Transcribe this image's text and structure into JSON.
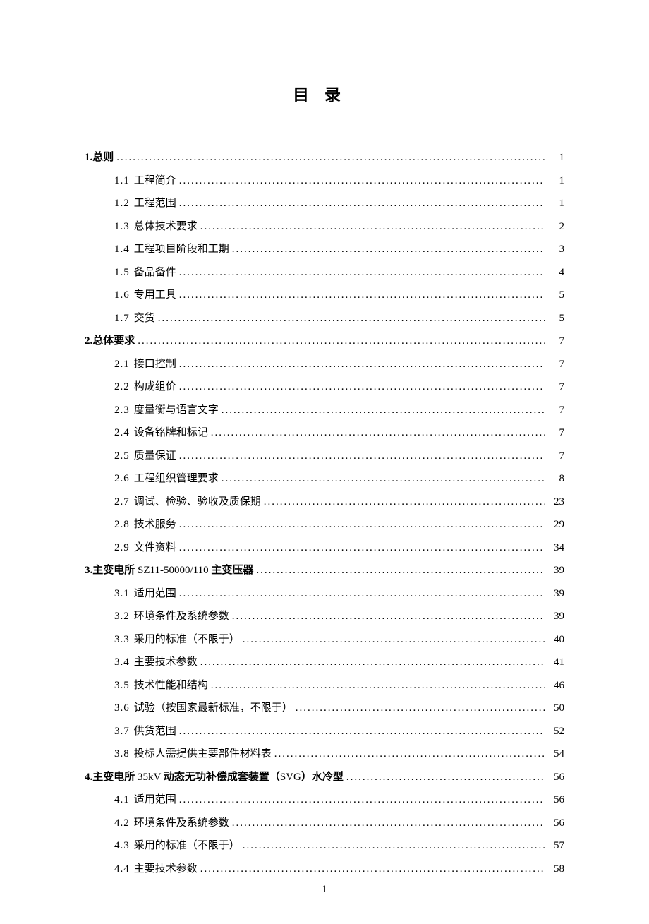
{
  "title": "目录",
  "footer_page": "1",
  "toc": [
    {
      "level": 1,
      "num": "1.",
      "label": "总则",
      "page": "1",
      "bold_all": true
    },
    {
      "level": 2,
      "num": "1.1",
      "label": "工程简介",
      "page": "1"
    },
    {
      "level": 2,
      "num": "1.2",
      "label": "工程范围",
      "page": "1"
    },
    {
      "level": 2,
      "num": "1.3",
      "label": "总体技术要求",
      "page": "2"
    },
    {
      "level": 2,
      "num": "1.4",
      "label": "工程项目阶段和工期",
      "page": "3"
    },
    {
      "level": 2,
      "num": "1.5",
      "label": "备品备件",
      "page": "4"
    },
    {
      "level": 2,
      "num": "1.6",
      "label": "专用工具",
      "page": "5"
    },
    {
      "level": 2,
      "num": "1.7",
      "label": "交货",
      "page": "5"
    },
    {
      "level": 1,
      "num": "2.",
      "label": "总体要求",
      "page": "7",
      "bold_all": true
    },
    {
      "level": 2,
      "num": "2.1",
      "label": "接口控制",
      "page": "7"
    },
    {
      "level": 2,
      "num": "2.2",
      "label": "构成组价",
      "page": "7"
    },
    {
      "level": 2,
      "num": "2.3",
      "label": "度量衡与语言文字",
      "page": "7"
    },
    {
      "level": 2,
      "num": "2.4",
      "label": "设备铭牌和标记",
      "page": "7"
    },
    {
      "level": 2,
      "num": "2.5",
      "label": "质量保证",
      "page": "7"
    },
    {
      "level": 2,
      "num": "2.6",
      "label": "工程组织管理要求",
      "page": "8"
    },
    {
      "level": 2,
      "num": "2.7",
      "label": "调试、检验、验收及质保期",
      "page": "23"
    },
    {
      "level": 2,
      "num": "2.8",
      "label": "技术服务",
      "page": "29"
    },
    {
      "level": 2,
      "num": "2.9",
      "label": "文件资料",
      "page": "34"
    },
    {
      "level": 1,
      "num": "3.",
      "label_parts": [
        {
          "t": "主变电所",
          "b": true
        },
        {
          "t": " SZ11-50000/110 ",
          "b": false
        },
        {
          "t": "主变压器",
          "b": true
        }
      ],
      "page": "39"
    },
    {
      "level": 2,
      "num": "3.1",
      "label": "适用范围",
      "page": "39"
    },
    {
      "level": 2,
      "num": "3.2",
      "label": "环境条件及系统参数",
      "page": "39"
    },
    {
      "level": 2,
      "num": "3.3",
      "label": "采用的标准（不限于）",
      "page": "40"
    },
    {
      "level": 2,
      "num": "3.4",
      "label": "主要技术参数",
      "page": "41"
    },
    {
      "level": 2,
      "num": "3.5",
      "label": "技术性能和结构",
      "page": "46"
    },
    {
      "level": 2,
      "num": "3.6",
      "label": "试验（按国家最新标准，不限于）",
      "page": "50"
    },
    {
      "level": 2,
      "num": "3.7",
      "label": "供货范围",
      "page": "52"
    },
    {
      "level": 2,
      "num": "3.8",
      "label": "投标人需提供主要部件材料表",
      "page": "54"
    },
    {
      "level": 1,
      "num": "4.",
      "label_parts": [
        {
          "t": "主变电所",
          "b": true
        },
        {
          "t": " 35kV ",
          "b": false
        },
        {
          "t": "动态无功补偿成套装置（",
          "b": true
        },
        {
          "t": "SVG",
          "b": false
        },
        {
          "t": "）水冷型",
          "b": true
        }
      ],
      "page": "56"
    },
    {
      "level": 2,
      "num": "4.1",
      "label": "适用范围",
      "page": "56"
    },
    {
      "level": 2,
      "num": "4.2",
      "label": "环境条件及系统参数",
      "page": "56"
    },
    {
      "level": 2,
      "num": "4.3",
      "label": "采用的标准（不限于）",
      "page": "57"
    },
    {
      "level": 2,
      "num": "4.4",
      "label": "主要技术参数",
      "page": "58"
    }
  ]
}
